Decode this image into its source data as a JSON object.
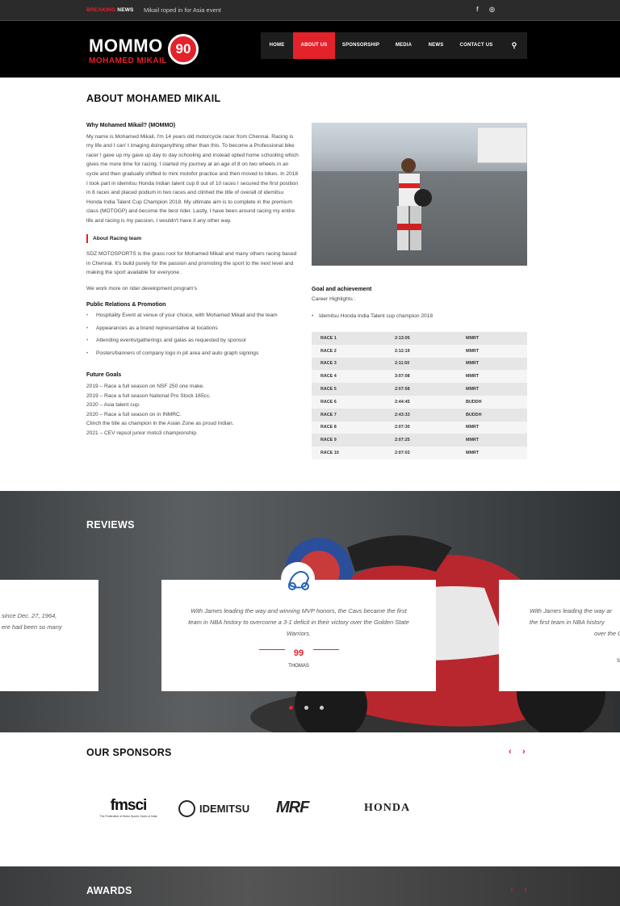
{
  "topbar": {
    "breaking_red": "BREAKING",
    "breaking_white": "NEWS",
    "news_text": "Mikail roped in for Asia event",
    "facebook_icon": "f",
    "instagram_icon": "◎"
  },
  "brand": {
    "main": "MOMMO",
    "number": "90",
    "sub": "MOHAMED MIKAIL"
  },
  "nav": {
    "items": [
      "HOME",
      "ABOUT US",
      "SPONSORSHIP",
      "MEDIA",
      "NEWS",
      "CONTACT US"
    ],
    "search_icon": "⚲"
  },
  "about": {
    "title": "ABOUT MOHAMED MIKAIL",
    "why_heading": "Why  Mohamed Mikail? (MOMMO)",
    "intro": "My name is Mohamed Mikail, I'm 14 years old motorcycle racer from Chennai. Racing is my life and I can' t imaging doinganything other than this. To become a Professional bike racer I gave up my gave up day to day  schooling and instead opted home schooling which gives me more time for racing.  I started my journey at an age of 8 on two wheels in an cycle and then gradually shifted to mini motofor practice and then moved to bikes. In 2018 I took part in idemitsu Honda Indian talent cup 8 out of 10 races I secured  the first position  in 8 races and placed podium in two races and clinhed the title of overall of idemitsu Honda India Talent Cup  Champion 2018. My ultimate aim is to complete in the premium class (MOTOGP) and become the best rider. Lastly, I have been around racing my entire life and racing is my passion, I wouldn't have it any other way.",
    "racing_team_heading": "About Racing team",
    "racing_team_text": "SDZ MOTOSPORTS is the grass root for Mohamed Mikail and many others racing based in Chennai.  It's build purely for the passion and promoting the sport to the next level and making the sport available for everyone .",
    "rider_program": "We work more on rider development  program's",
    "pr_heading": "Public Relations & Promotion",
    "pr_items": [
      "Hospitality Event at venue of your choice, with Mohamed Mikail and the team",
      "Appearances as a brand representative at locations",
      "Attending events/gatherings and galas as requested by sponsor",
      "Posters/banners of company logo in pit area and auto graph signings"
    ],
    "future_heading": "Future Goals",
    "future_items": [
      "2019 – Race a full season on NSF 250 one make.",
      "2019 – Race a full season National Pro Stock 165cc.",
      "2020 – Asia talent cup.",
      "2020 – Race a full season on in INMRC.",
      "Clinch the title as champion in the Asian Zone as proud Indian.",
      "2021 – CEV repsol junior moto3 championship."
    ],
    "goal_heading": "Goal and achievement",
    "career_label": "Career  Highlights :",
    "highlight": "Idemitsu Honda India Talent cup champion 2018"
  },
  "races": [
    {
      "race": "RACE 1",
      "time": "2:13:05",
      "track": "MMRT"
    },
    {
      "race": "RACE 2",
      "time": "2:12:19",
      "track": "MMRT"
    },
    {
      "race": "RACE 3",
      "time": "2:11:50",
      "track": "MMRT"
    },
    {
      "race": "RACE 4",
      "time": "3:07:08",
      "track": "MMRT"
    },
    {
      "race": "RACE 5",
      "time": "2:07:58",
      "track": "MMRT"
    },
    {
      "race": "RACE 6",
      "time": "2:44:45",
      "track": "BUDDH"
    },
    {
      "race": "RACE 7",
      "time": "2:43:33",
      "track": "BUDDH"
    },
    {
      "race": "RACE 8",
      "time": "2:07:30",
      "track": "MMRT"
    },
    {
      "race": "RACE 9",
      "time": "2:07:25",
      "track": "MMRT"
    },
    {
      "race": "RACE 10",
      "time": "2:07:03",
      "track": "MMRT"
    }
  ],
  "reviews": {
    "title": "REVIEWS",
    "left_text_1": "since Dec. 27, 1964,",
    "left_text_2": "ere had been so many",
    "main_text": "With James leading the way and winning MVP honors, the Cavs became the first team in NBA history to overcome a 3-1 deficit in their victory over the Golden State Warriors.",
    "author": "THOMAS",
    "quote_mark": "99",
    "right_text_1": "With James leading the way ar",
    "right_text_2": "the first team in NBA history",
    "right_text_3": "over the G",
    "right_author": "S",
    "accent": "#e4222b"
  },
  "sponsors": {
    "title": "OUR SPONSORS",
    "prev": "‹",
    "next": "›",
    "logos": [
      "fmsci",
      "IDEMITSU",
      "MRF",
      "HONDA"
    ],
    "fmsci_tag": "The Federation of Motor Sports Clubs of India"
  },
  "awards": {
    "title": "AWARDS",
    "prev": "‹",
    "next": "›"
  }
}
